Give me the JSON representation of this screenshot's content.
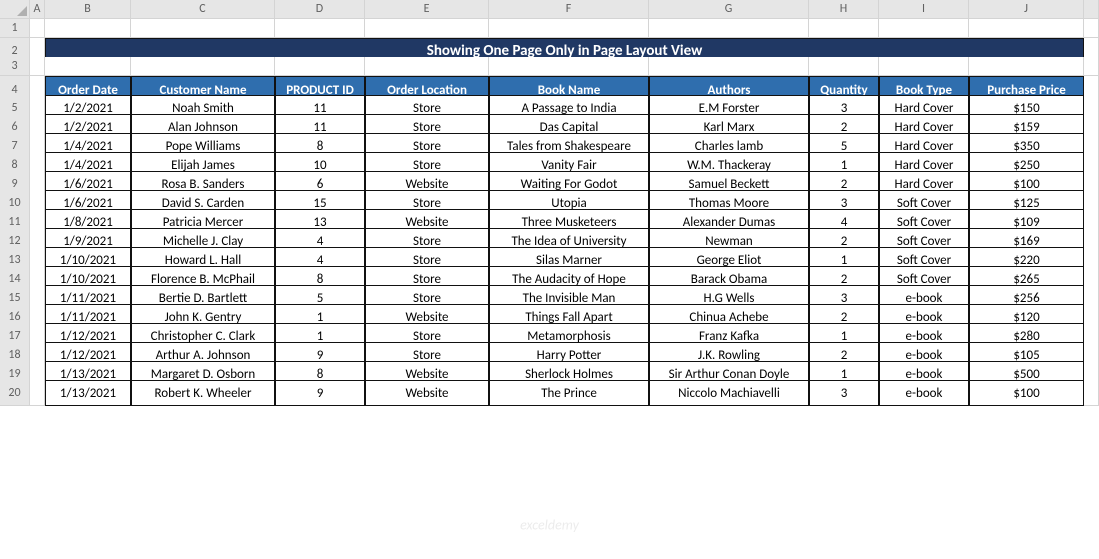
{
  "columns": [
    "A",
    "B",
    "C",
    "D",
    "E",
    "F",
    "G",
    "H",
    "I",
    "J"
  ],
  "title": "Showing One Page Only in Page Layout View",
  "headers": [
    "Order Date",
    "Customer Name",
    "PRODUCT ID",
    "Order Location",
    "Book Name",
    "Authors",
    "Quantity",
    "Book Type",
    "Purchase Price"
  ],
  "rows": [
    {
      "n": 5,
      "d": [
        "1/2/2021",
        "Noah Smith",
        "11",
        "Store",
        "A Passage to India",
        "E.M Forster",
        "3",
        "Hard Cover",
        "$150"
      ]
    },
    {
      "n": 6,
      "d": [
        "1/2/2021",
        "Alan Johnson",
        "11",
        "Store",
        "Das Capital",
        "Karl Marx",
        "2",
        "Hard Cover",
        "$159"
      ]
    },
    {
      "n": 7,
      "d": [
        "1/4/2021",
        "Pope Williams",
        "8",
        "Store",
        "Tales from Shakespeare",
        "Charles lamb",
        "5",
        "Hard Cover",
        "$350"
      ]
    },
    {
      "n": 8,
      "d": [
        "1/4/2021",
        "Elijah James",
        "10",
        "Store",
        "Vanity Fair",
        "W.M. Thackeray",
        "1",
        "Hard Cover",
        "$250"
      ]
    },
    {
      "n": 9,
      "d": [
        "1/6/2021",
        "Rosa B. Sanders",
        "6",
        "Website",
        "Waiting For Godot",
        "Samuel Beckett",
        "2",
        "Hard Cover",
        "$100"
      ]
    },
    {
      "n": 10,
      "d": [
        "1/6/2021",
        "David S. Carden",
        "15",
        "Store",
        "Utopia",
        "Thomas Moore",
        "3",
        "Soft Cover",
        "$125"
      ]
    },
    {
      "n": 11,
      "d": [
        "1/8/2021",
        "Patricia Mercer",
        "13",
        "Website",
        "Three Musketeers",
        "Alexander Dumas",
        "4",
        "Soft Cover",
        "$109"
      ]
    },
    {
      "n": 12,
      "d": [
        "1/9/2021",
        "Michelle J. Clay",
        "4",
        "Store",
        "The Idea of University",
        "Newman",
        "2",
        "Soft Cover",
        "$169"
      ]
    },
    {
      "n": 13,
      "d": [
        "1/10/2021",
        "Howard L. Hall",
        "4",
        "Store",
        "Silas Marner",
        "George Eliot",
        "1",
        "Soft Cover",
        "$220"
      ]
    },
    {
      "n": 14,
      "d": [
        "1/10/2021",
        "Florence B. McPhail",
        "8",
        "Store",
        "The Audacity of Hope",
        "Barack Obama",
        "2",
        "Soft Cover",
        "$265"
      ]
    },
    {
      "n": 15,
      "d": [
        "1/11/2021",
        "Bertie D. Bartlett",
        "5",
        "Store",
        "The Invisible Man",
        "H.G Wells",
        "3",
        "e-book",
        "$256"
      ]
    },
    {
      "n": 16,
      "d": [
        "1/11/2021",
        "John K. Gentry",
        "1",
        "Website",
        "Things Fall Apart",
        "Chinua Achebe",
        "2",
        "e-book",
        "$120"
      ]
    },
    {
      "n": 17,
      "d": [
        "1/12/2021",
        "Christopher C. Clark",
        "1",
        "Store",
        "Metamorphosis",
        "Franz Kafka",
        "1",
        "e-book",
        "$280"
      ]
    },
    {
      "n": 18,
      "d": [
        "1/12/2021",
        "Arthur A. Johnson",
        "9",
        "Store",
        "Harry Potter",
        "J.K. Rowling",
        "2",
        "e-book",
        "$105"
      ]
    },
    {
      "n": 19,
      "d": [
        "1/13/2021",
        "Margaret D. Osborn",
        "8",
        "Website",
        "Sherlock Holmes",
        "Sir Arthur Conan Doyle",
        "1",
        "e-book",
        "$500"
      ]
    },
    {
      "n": 20,
      "d": [
        "1/13/2021",
        "Robert K. Wheeler",
        "9",
        "Website",
        "The Prince",
        "Niccolo Machiavelli",
        "3",
        "e-book",
        "$100"
      ]
    }
  ],
  "watermark": "exceldemy"
}
